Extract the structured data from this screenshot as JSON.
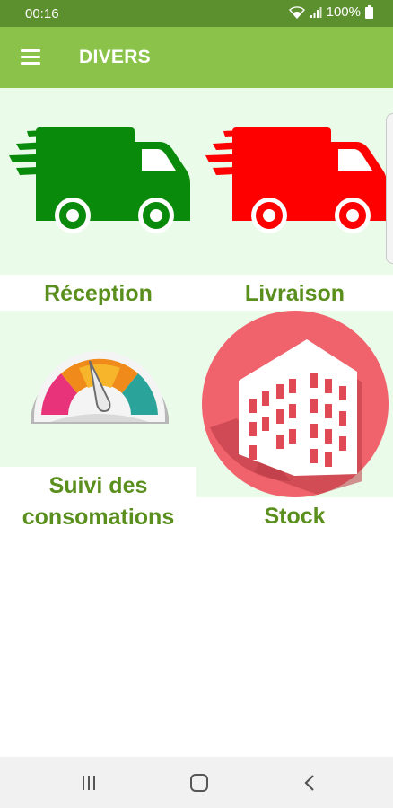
{
  "status_bar": {
    "time": "00:16",
    "battery": "100%"
  },
  "app_bar": {
    "title": "DIVERS"
  },
  "tiles": [
    {
      "label": "Réception",
      "icon": "green-truck-icon",
      "color": "#0a8a0a"
    },
    {
      "label": "Livraison",
      "icon": "red-truck-icon",
      "color": "#ff0000"
    },
    {
      "label": "Suivi des consomations",
      "icon": "gauge-icon"
    },
    {
      "label": "Stock",
      "icon": "building-icon",
      "color": "#f0636d"
    }
  ],
  "colors": {
    "status_bar": "#5c8f2e",
    "app_bar": "#8bc34a",
    "label": "#5a8f1d",
    "tile_bg": "#eafbe9"
  },
  "nav": [
    "recent-apps-icon",
    "home-icon",
    "back-icon"
  ]
}
